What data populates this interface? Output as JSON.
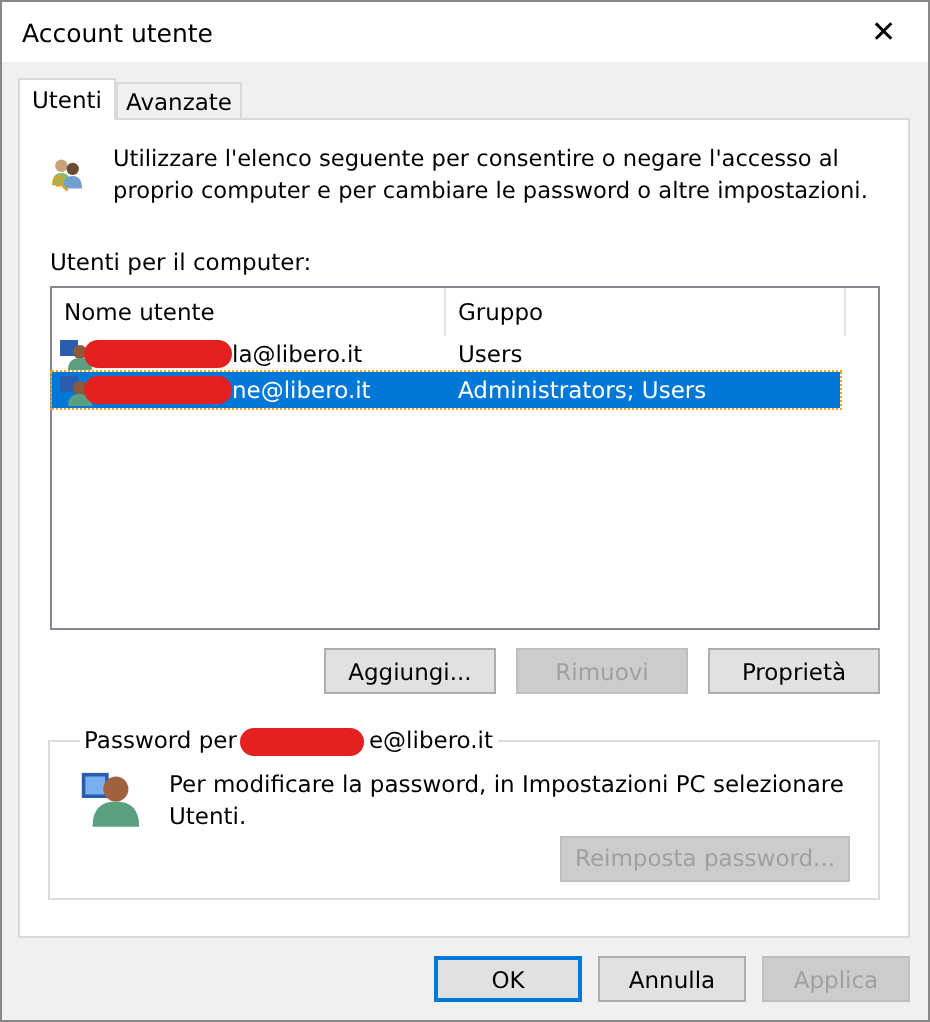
{
  "window": {
    "title": "Account utente",
    "close": "✕"
  },
  "tabs": [
    {
      "label": "Utenti",
      "selected": true
    },
    {
      "label": "Avanzate",
      "selected": false
    }
  ],
  "intro": "Utilizzare l'elenco seguente per consentire o negare l'accesso al proprio computer e per cambiare le password o altre impostazioni.",
  "list_label": "Utenti per il computer:",
  "table": {
    "columns": [
      "Nome utente",
      "Gruppo"
    ],
    "rows": [
      {
        "name": "la@libero.it",
        "group": "Users",
        "selected": false,
        "redacted": true
      },
      {
        "name": "ne@libero.it",
        "group": "Administrators; Users",
        "selected": true,
        "redacted": true
      }
    ]
  },
  "list_buttons": [
    {
      "label": "Aggiungi...",
      "disabled": false
    },
    {
      "label": "Rimuovi",
      "disabled": true
    },
    {
      "label": "Proprietà",
      "disabled": false
    }
  ],
  "password_group": {
    "title_start": "Password per",
    "title_end": "e@libero.it",
    "redacted": true,
    "text": "Per modificare la password, in Impostazioni PC selezionare Utenti.",
    "button": {
      "label": "Reimposta password...",
      "disabled": true
    }
  },
  "footer_buttons": [
    {
      "label": "OK",
      "disabled": false,
      "default": true
    },
    {
      "label": "Annulla",
      "disabled": false,
      "default": false
    },
    {
      "label": "Applica",
      "disabled": true,
      "default": false
    }
  ]
}
